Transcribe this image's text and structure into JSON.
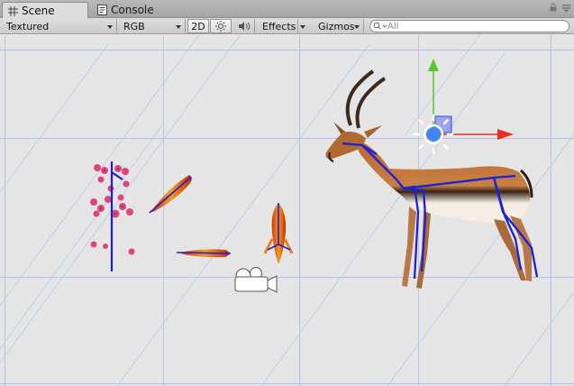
{
  "tabs": [
    {
      "label": "Scene",
      "icon": "grid-icon",
      "active": true
    },
    {
      "label": "Console",
      "icon": "console-icon",
      "active": false
    }
  ],
  "toolbar": {
    "shading_mode": "Textured",
    "render_mode": "RGB",
    "mode_2d": "2D",
    "lighting_icon": "sun-icon",
    "audio_icon": "speaker-icon",
    "effects_label": "Effects",
    "gizmos_label": "Gizmos",
    "search_placeholder": "All",
    "search_icon": "search-icon"
  },
  "scene": {
    "objects": [
      "flower-sprite",
      "fish-sprite-left",
      "fish-sprite-bottom",
      "fish-sprite-vertical",
      "gazelle-sprite",
      "camera-gizmo",
      "move-gizmo"
    ],
    "gizmo_colors": {
      "x_axis": "#e3301f",
      "y_axis": "#59c431",
      "center": "#3f86f0",
      "bones": "#1a22d8"
    }
  }
}
